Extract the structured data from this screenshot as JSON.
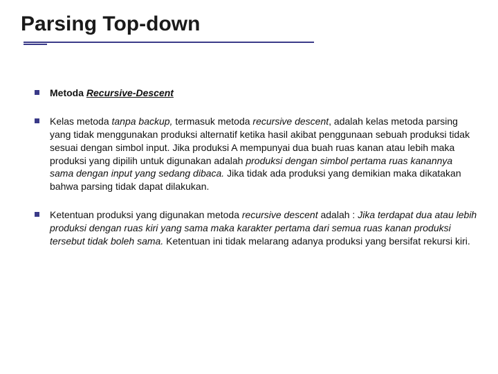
{
  "title": "Parsing Top-down",
  "b1": {
    "label": "Metoda ",
    "term": "Recursive-Descent"
  },
  "b2": {
    "t1": "Kelas metoda ",
    "i1": "tanpa backup, ",
    "t2": "termasuk metoda ",
    "i2": "recursive descent",
    "t3": ", adalah kelas metoda parsing yang tidak menggunakan produksi alternatif ketika hasil akibat penggunaan sebuah produksi tidak sesuai dengan simbol input. Jika produksi A mempunyai dua buah ruas kanan atau lebih maka produksi yang dipilih untuk digunakan adalah ",
    "i3": "produksi dengan simbol pertama ruas kanannya sama dengan input yang sedang dibaca. ",
    "t4": "Jika tidak ada produksi yang demikian maka dikatakan bahwa parsing tidak dapat dilakukan."
  },
  "b3": {
    "t1": "Ketentuan produksi yang digunakan metoda ",
    "i1": "recursive descent ",
    "t2": "adalah : ",
    "i2": "Jika terdapat dua atau lebih produksi dengan ruas kiri yang sama maka karakter pertama dari semua ruas kanan produksi tersebut tidak boleh sama. ",
    "t3": "Ketentuan ini tidak melarang adanya produksi yang bersifat rekursi kiri."
  }
}
